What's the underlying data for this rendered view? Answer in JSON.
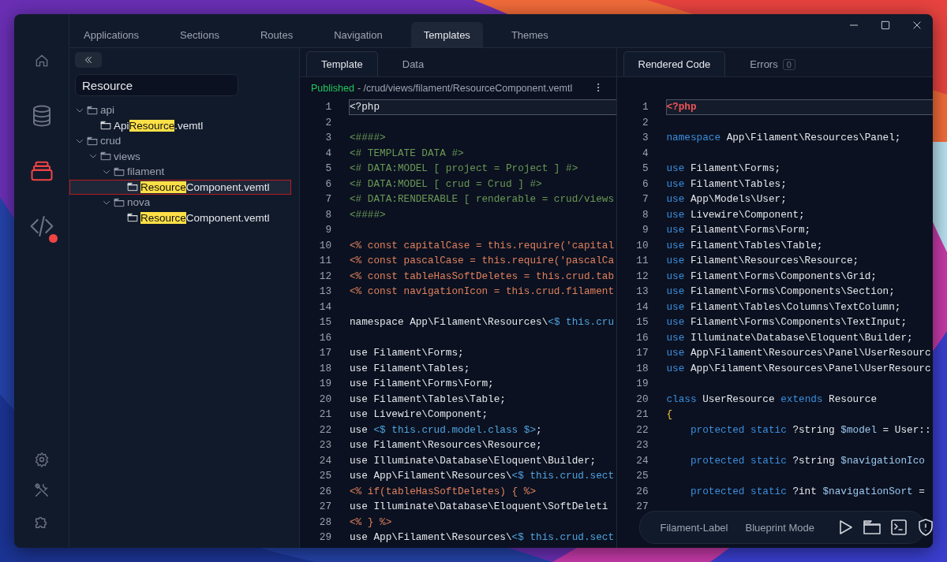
{
  "activity_bar": [
    {
      "selected": false
    },
    {
      "selected": false
    },
    {
      "selected": true
    },
    {
      "selected": false,
      "notification": true
    }
  ],
  "tabs": [
    {
      "label": "Applications",
      "selected": false
    },
    {
      "label": "Sections",
      "selected": false
    },
    {
      "label": "Routes",
      "selected": false
    },
    {
      "label": "Navigation",
      "selected": false
    },
    {
      "label": "Templates",
      "selected": true
    },
    {
      "label": "Themes",
      "selected": false
    }
  ],
  "explorer": {
    "search": {
      "value": "Resource"
    },
    "tree": [
      {
        "kind": "folder",
        "label": "api",
        "expanded": true,
        "selected": false,
        "children": [
          {
            "kind": "file",
            "before": "Api",
            "match": "Resource",
            "after": ".vemtl",
            "selected": false
          }
        ]
      },
      {
        "kind": "folder",
        "label": "crud",
        "expanded": true,
        "selected": false,
        "children": [
          {
            "kind": "folder",
            "label": "views",
            "expanded": true,
            "selected": false,
            "children": [
              {
                "kind": "folder",
                "label": "filament",
                "expanded": true,
                "selected": false,
                "children": [
                  {
                    "kind": "file",
                    "match": "Resource",
                    "after": "Component.vemtl",
                    "selected": true
                  }
                ]
              },
              {
                "kind": "folder",
                "label": "nova",
                "expanded": true,
                "selected": false,
                "children": [
                  {
                    "kind": "file",
                    "match": "Resource",
                    "after": "Component.vemtl",
                    "selected": false
                  }
                ]
              }
            ]
          }
        ]
      }
    ]
  },
  "template_pane": {
    "tabs": [
      {
        "label": "Template",
        "selected": true
      },
      {
        "label": "Data",
        "selected": false
      }
    ],
    "status": "Published",
    "path": "- /crud/views/filament/ResourceComponent.vemtl",
    "lines": [
      {
        "number": "1",
        "current": true,
        "tokens": [
          {
            "kind": "plain",
            "text": "<?php"
          }
        ]
      },
      {
        "number": "2"
      },
      {
        "number": "3",
        "current": false,
        "tokens": [
          {
            "kind": "comment",
            "text": "<####>"
          }
        ]
      },
      {
        "number": "4",
        "current": false,
        "tokens": [
          {
            "kind": "comment",
            "text": "<# TEMPLATE DATA #>"
          }
        ]
      },
      {
        "number": "5",
        "current": false,
        "tokens": [
          {
            "kind": "comment",
            "text": "<# DATA:MODEL [ project = Project ] #>"
          }
        ]
      },
      {
        "number": "6",
        "current": false,
        "tokens": [
          {
            "kind": "comment",
            "text": "<# DATA:MODEL [ crud = Crud ] #>"
          }
        ]
      },
      {
        "number": "7",
        "current": false,
        "tokens": [
          {
            "kind": "comment",
            "text": "<# DATA:RENDERABLE [ renderable = crud/views"
          }
        ]
      },
      {
        "number": "8",
        "current": false,
        "tokens": [
          {
            "kind": "comment",
            "text": "<####>"
          }
        ]
      },
      {
        "number": "9"
      },
      {
        "number": "10",
        "current": false,
        "tokens": [
          {
            "kind": "directive",
            "text": "<% const capitalCase = this.require('capital"
          }
        ]
      },
      {
        "number": "11",
        "current": false,
        "tokens": [
          {
            "kind": "directive",
            "text": "<% const pascalCase = this.require('pascalCa"
          }
        ]
      },
      {
        "number": "12",
        "current": false,
        "tokens": [
          {
            "kind": "directive",
            "text": "<% const tableHasSoftDeletes = this.crud.tab"
          }
        ]
      },
      {
        "number": "13",
        "current": false,
        "tokens": [
          {
            "kind": "directive",
            "text": "<% const navigationIcon = this.crud.filament"
          }
        ]
      },
      {
        "number": "14"
      },
      {
        "number": "15",
        "current": false,
        "tokens": [
          {
            "kind": "plain",
            "text": "namespace App\\Filament\\Resources\\"
          },
          {
            "kind": "expr",
            "text": "<$ this.cru"
          }
        ]
      },
      {
        "number": "16"
      },
      {
        "number": "17",
        "current": false,
        "tokens": [
          {
            "kind": "plain",
            "text": "use Filament\\Forms;"
          }
        ]
      },
      {
        "number": "18",
        "current": false,
        "tokens": [
          {
            "kind": "plain",
            "text": "use Filament\\Tables;"
          }
        ]
      },
      {
        "number": "19",
        "current": false,
        "tokens": [
          {
            "kind": "plain",
            "text": "use Filament\\Forms\\Form;"
          }
        ]
      },
      {
        "number": "20",
        "current": false,
        "tokens": [
          {
            "kind": "plain",
            "text": "use Filament\\Tables\\Table;"
          }
        ]
      },
      {
        "number": "21",
        "current": false,
        "tokens": [
          {
            "kind": "plain",
            "text": "use Livewire\\Component;"
          }
        ]
      },
      {
        "number": "22",
        "current": false,
        "tokens": [
          {
            "kind": "plain",
            "text": "use "
          },
          {
            "kind": "expr",
            "text": "<$ this.crud.model.class $>"
          },
          {
            "kind": "plain",
            "text": ";"
          }
        ]
      },
      {
        "number": "23",
        "current": false,
        "tokens": [
          {
            "kind": "plain",
            "text": "use Filament\\Resources\\Resource;"
          }
        ]
      },
      {
        "number": "24",
        "current": false,
        "tokens": [
          {
            "kind": "plain",
            "text": "use Illuminate\\Database\\Eloquent\\Builder;"
          }
        ]
      },
      {
        "number": "25",
        "current": false,
        "tokens": [
          {
            "kind": "plain",
            "text": "use App\\Filament\\Resources\\"
          },
          {
            "kind": "expr",
            "text": "<$ this.crud.sect"
          }
        ]
      },
      {
        "number": "26",
        "current": false,
        "tokens": [
          {
            "kind": "directive",
            "text": "<% if(tableHasSoftDeletes) { %>"
          }
        ]
      },
      {
        "number": "27",
        "current": false,
        "tokens": [
          {
            "kind": "plain",
            "text": "use Illuminate\\Database\\Eloquent\\SoftDeleti"
          }
        ]
      },
      {
        "number": "28",
        "current": false,
        "tokens": [
          {
            "kind": "directive",
            "text": "<% } %>"
          }
        ]
      },
      {
        "number": "29",
        "current": false,
        "tokens": [
          {
            "kind": "plain",
            "text": "use App\\Filament\\Resources\\"
          },
          {
            "kind": "expr",
            "text": "<$ this.crud.sect"
          }
        ]
      }
    ]
  },
  "output_pane": {
    "tabs": [
      {
        "label": "Rendered Code",
        "selected": true
      },
      {
        "label": "Errors",
        "count": "0",
        "selected": false
      }
    ],
    "lines": [
      {
        "number": "1",
        "current": true,
        "tokens": [
          {
            "kind": "php_tag",
            "text": "<?php"
          }
        ]
      },
      {
        "number": "2"
      },
      {
        "number": "3",
        "current": false,
        "tokens": [
          {
            "kind": "keyword",
            "text": "namespace"
          },
          {
            "kind": "plain",
            "text": " App\\Filament\\Resources\\Panel;"
          }
        ]
      },
      {
        "number": "4"
      },
      {
        "number": "5",
        "current": false,
        "tokens": [
          {
            "kind": "keyword",
            "text": "use"
          },
          {
            "kind": "plain",
            "text": " Filament\\Forms;"
          }
        ]
      },
      {
        "number": "6",
        "current": false,
        "tokens": [
          {
            "kind": "keyword",
            "text": "use"
          },
          {
            "kind": "plain",
            "text": " Filament\\Tables;"
          }
        ]
      },
      {
        "number": "7",
        "current": false,
        "tokens": [
          {
            "kind": "keyword",
            "text": "use"
          },
          {
            "kind": "plain",
            "text": " App\\Models\\User;"
          }
        ]
      },
      {
        "number": "8",
        "current": false,
        "tokens": [
          {
            "kind": "keyword",
            "text": "use"
          },
          {
            "kind": "plain",
            "text": " Livewire\\Component;"
          }
        ]
      },
      {
        "number": "9",
        "current": false,
        "tokens": [
          {
            "kind": "keyword",
            "text": "use"
          },
          {
            "kind": "plain",
            "text": " Filament\\Forms\\Form;"
          }
        ]
      },
      {
        "number": "10",
        "current": false,
        "tokens": [
          {
            "kind": "keyword",
            "text": "use"
          },
          {
            "kind": "plain",
            "text": " Filament\\Tables\\Table;"
          }
        ]
      },
      {
        "number": "11",
        "current": false,
        "tokens": [
          {
            "kind": "keyword",
            "text": "use"
          },
          {
            "kind": "plain",
            "text": " Filament\\Resources\\Resource;"
          }
        ]
      },
      {
        "number": "12",
        "current": false,
        "tokens": [
          {
            "kind": "keyword",
            "text": "use"
          },
          {
            "kind": "plain",
            "text": " Filament\\Forms\\Components\\Grid;"
          }
        ]
      },
      {
        "number": "13",
        "current": false,
        "tokens": [
          {
            "kind": "keyword",
            "text": "use"
          },
          {
            "kind": "plain",
            "text": " Filament\\Forms\\Components\\Section;"
          }
        ]
      },
      {
        "number": "14",
        "current": false,
        "tokens": [
          {
            "kind": "keyword",
            "text": "use"
          },
          {
            "kind": "plain",
            "text": " Filament\\Tables\\Columns\\TextColumn;"
          }
        ]
      },
      {
        "number": "15",
        "current": false,
        "tokens": [
          {
            "kind": "keyword",
            "text": "use"
          },
          {
            "kind": "plain",
            "text": " Filament\\Forms\\Components\\TextInput;"
          }
        ]
      },
      {
        "number": "16",
        "current": false,
        "tokens": [
          {
            "kind": "keyword",
            "text": "use"
          },
          {
            "kind": "plain",
            "text": " Illuminate\\Database\\Eloquent\\Builder;"
          }
        ]
      },
      {
        "number": "17",
        "current": false,
        "tokens": [
          {
            "kind": "keyword",
            "text": "use"
          },
          {
            "kind": "plain",
            "text": " App\\Filament\\Resources\\Panel\\UserResourc"
          }
        ]
      },
      {
        "number": "18",
        "current": false,
        "tokens": [
          {
            "kind": "keyword",
            "text": "use"
          },
          {
            "kind": "plain",
            "text": " App\\Filament\\Resources\\Panel\\UserResourc"
          }
        ]
      },
      {
        "number": "19"
      },
      {
        "number": "20",
        "current": false,
        "tokens": [
          {
            "kind": "keyword",
            "text": "class"
          },
          {
            "kind": "plain",
            "text": " UserResource "
          },
          {
            "kind": "keyword",
            "text": "extends"
          },
          {
            "kind": "plain",
            "text": " Resource"
          }
        ]
      },
      {
        "number": "21",
        "current": false,
        "tokens": [
          {
            "kind": "brace",
            "text": "{"
          }
        ]
      },
      {
        "number": "22",
        "current": false,
        "indent": true,
        "tokens": [
          {
            "kind": "keyword",
            "text": "protected static"
          },
          {
            "kind": "plain",
            "text": " ?string "
          },
          {
            "kind": "variable",
            "text": "$model"
          },
          {
            "kind": "plain",
            "text": " = User::"
          }
        ]
      },
      {
        "number": "23"
      },
      {
        "number": "24",
        "current": false,
        "indent": true,
        "tokens": [
          {
            "kind": "keyword",
            "text": "protected static"
          },
          {
            "kind": "plain",
            "text": " ?string "
          },
          {
            "kind": "variable",
            "text": "$navigationIco"
          }
        ]
      },
      {
        "number": "25"
      },
      {
        "number": "26",
        "current": false,
        "indent": true,
        "tokens": [
          {
            "kind": "keyword",
            "text": "protected static"
          },
          {
            "kind": "plain",
            "text": " ?int "
          },
          {
            "kind": "variable",
            "text": "$navigationSort"
          },
          {
            "kind": "plain",
            "text": " ="
          }
        ]
      },
      {
        "number": "27"
      }
    ]
  },
  "toolbar": {
    "label": "Filament-Label",
    "mode": "Blueprint Mode"
  }
}
